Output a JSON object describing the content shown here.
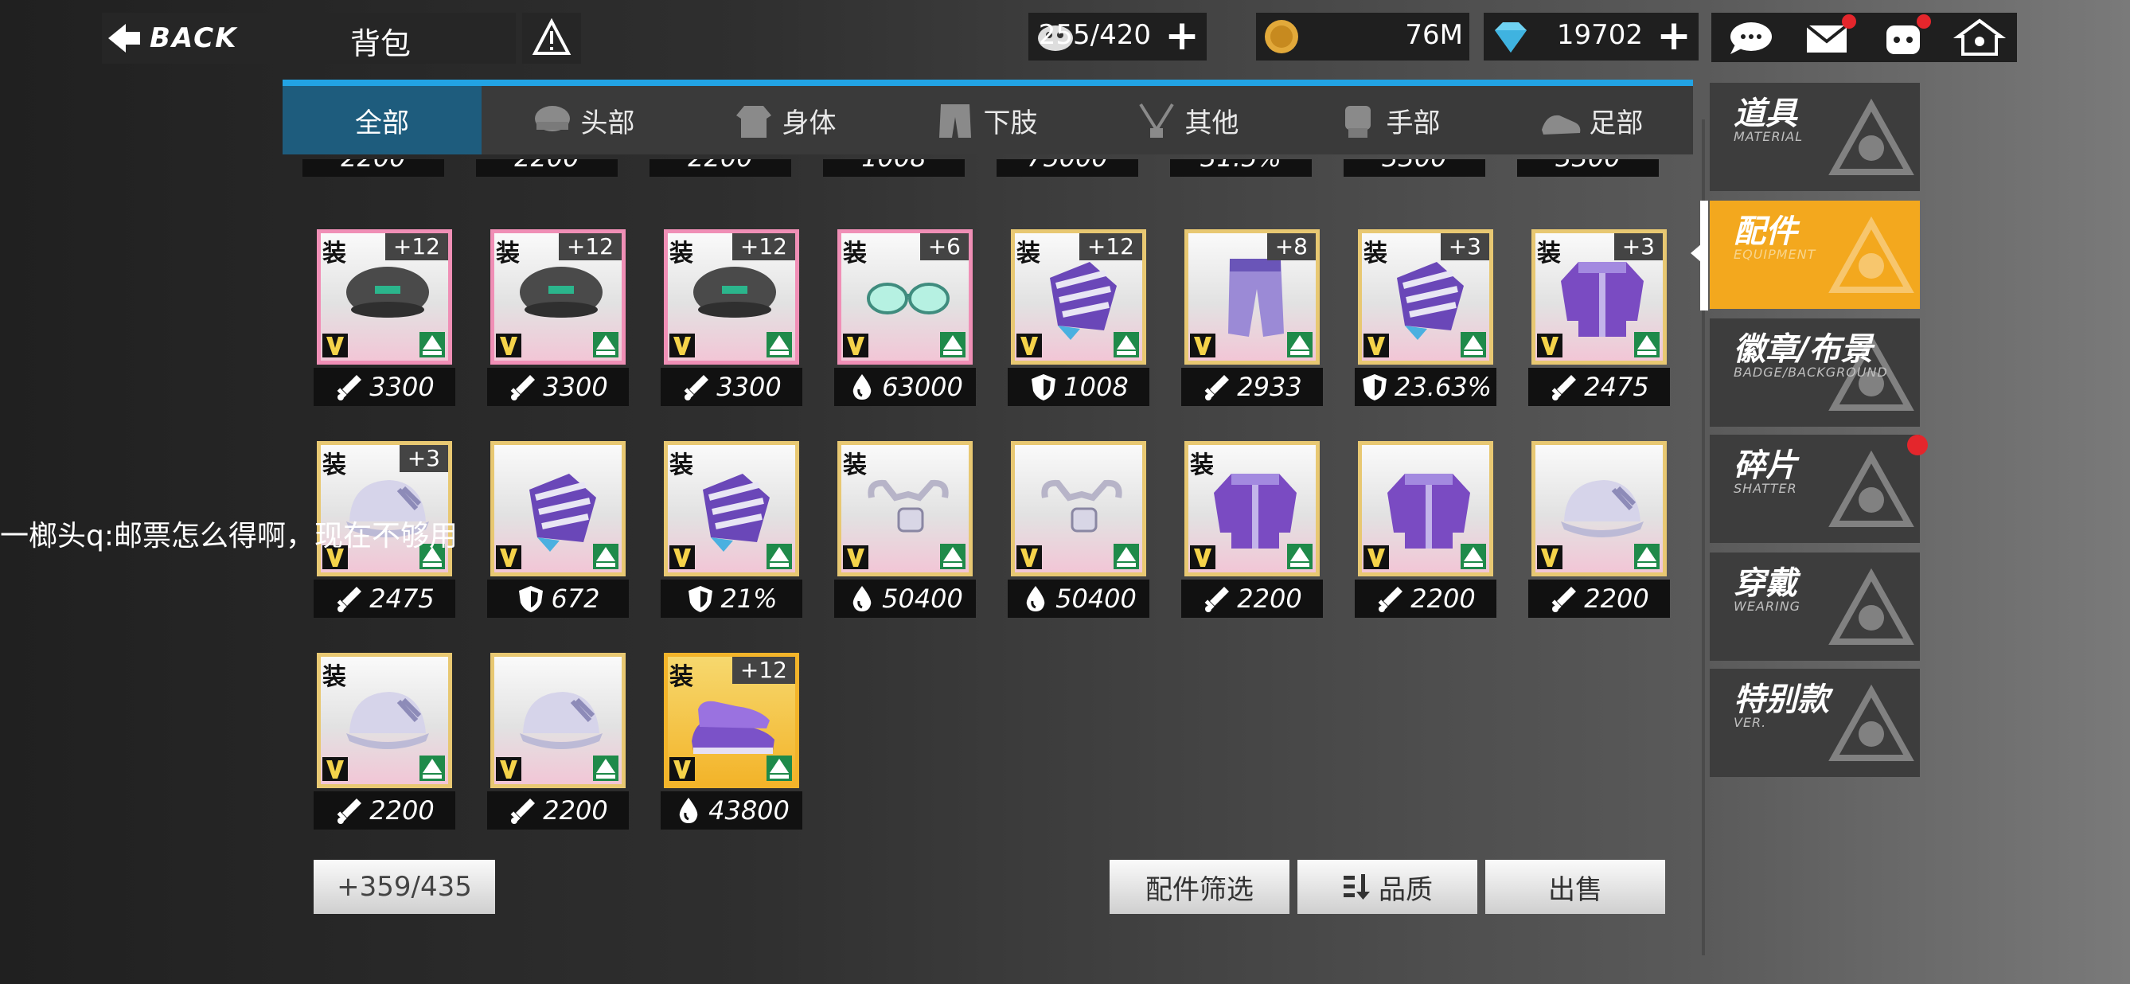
{
  "topbar": {
    "back_label": "BACK",
    "title": "背包",
    "resources": [
      {
        "icon": "stamina-icon",
        "value": "255/420",
        "plus": "+"
      },
      {
        "icon": "coin-icon",
        "value": "76M",
        "plus": ""
      },
      {
        "icon": "diamond-icon",
        "value": "19702",
        "plus": "+"
      }
    ],
    "icons": [
      "chat-icon",
      "mail-icon",
      "character-icon",
      "home-icon"
    ]
  },
  "tabs": [
    {
      "label": "全部",
      "icon": "",
      "active": true
    },
    {
      "label": "头部",
      "icon": "head-icon"
    },
    {
      "label": "身体",
      "icon": "body-icon"
    },
    {
      "label": "下肢",
      "icon": "legs-icon"
    },
    {
      "label": "其他",
      "icon": "misc-icon"
    },
    {
      "label": "手部",
      "icon": "hand-icon"
    },
    {
      "label": "足部",
      "icon": "foot-icon"
    }
  ],
  "partial_row": [
    "2200",
    "2200",
    "2200",
    "1008",
    "75000",
    "31.5%",
    "3300",
    "3300"
  ],
  "items": [
    {
      "equipped": "装",
      "level": "+12",
      "type": "cap",
      "border": "pink",
      "stat_icon": "sword-icon",
      "stat": "3300"
    },
    {
      "equipped": "装",
      "level": "+12",
      "type": "cap",
      "border": "pink",
      "stat_icon": "sword-icon",
      "stat": "3300"
    },
    {
      "equipped": "装",
      "level": "+12",
      "type": "cap",
      "border": "pink",
      "stat_icon": "sword-icon",
      "stat": "3300"
    },
    {
      "equipped": "装",
      "level": "+6",
      "type": "glasses",
      "border": "pink",
      "stat_icon": "drop-icon",
      "stat": "63000"
    },
    {
      "equipped": "装",
      "level": "+12",
      "type": "glove",
      "border": "gold",
      "stat_icon": "shield-icon",
      "stat": "1008"
    },
    {
      "equipped": "",
      "level": "+8",
      "type": "pants",
      "border": "gold",
      "stat_icon": "sword-icon",
      "stat": "2933"
    },
    {
      "equipped": "装",
      "level": "+3",
      "type": "glove",
      "border": "gold",
      "stat_icon": "shield-icon",
      "stat": "23.63%"
    },
    {
      "equipped": "装",
      "level": "+3",
      "type": "jacket",
      "border": "gold",
      "stat_icon": "sword-icon",
      "stat": "2475"
    },
    {
      "equipped": "装",
      "level": "+3",
      "type": "whitecap",
      "border": "gold",
      "stat_icon": "sword-icon",
      "stat": "2475"
    },
    {
      "equipped": "",
      "level": "",
      "type": "glove",
      "border": "gold",
      "stat_icon": "shield-icon",
      "stat": "672"
    },
    {
      "equipped": "装",
      "level": "",
      "type": "glove",
      "border": "gold",
      "stat_icon": "shield-icon",
      "stat": "21%"
    },
    {
      "equipped": "装",
      "level": "",
      "type": "mask",
      "border": "gold",
      "stat_icon": "drop-icon",
      "stat": "50400"
    },
    {
      "equipped": "",
      "level": "",
      "type": "mask",
      "border": "gold",
      "stat_icon": "drop-icon",
      "stat": "50400"
    },
    {
      "equipped": "装",
      "level": "",
      "type": "jacket",
      "border": "gold",
      "stat_icon": "sword-icon",
      "stat": "2200"
    },
    {
      "equipped": "",
      "level": "",
      "type": "jacket",
      "border": "gold",
      "stat_icon": "sword-icon",
      "stat": "2200"
    },
    {
      "equipped": "",
      "level": "",
      "type": "whitecap",
      "border": "gold",
      "stat_icon": "sword-icon",
      "stat": "2200"
    },
    {
      "equipped": "装",
      "level": "",
      "type": "whitecap",
      "border": "gold",
      "stat_icon": "sword-icon",
      "stat": "2200"
    },
    {
      "equipped": "",
      "level": "",
      "type": "whitecap",
      "border": "gold",
      "stat_icon": "sword-icon",
      "stat": "2200"
    },
    {
      "equipped": "装",
      "level": "+12",
      "type": "shoes",
      "border": "goldbg",
      "stat_icon": "drop-icon",
      "stat": "43800"
    }
  ],
  "bottom": {
    "count": "+359/435",
    "filter": "配件筛选",
    "sort": "品质",
    "sell": "出售"
  },
  "categories": [
    {
      "title": "道具",
      "sub": "MATERIAL",
      "active": false,
      "dot": false
    },
    {
      "title": "配件",
      "sub": "EQUIPMENT",
      "active": true,
      "dot": false
    },
    {
      "title": "徽章/布景",
      "sub": "BADGE/BACKGROUND",
      "active": false,
      "dot": false
    },
    {
      "title": "碎片",
      "sub": "SHATTER",
      "active": false,
      "dot": true
    },
    {
      "title": "穿戴",
      "sub": "WEARING",
      "active": false,
      "dot": false
    },
    {
      "title": "特别款",
      "sub": "VER.",
      "active": false,
      "dot": false
    }
  ],
  "chat_overlay": "一榔头q:邮票怎么得啊，现在不够用",
  "colors": {
    "accent": "#22a3e4",
    "active_tab": "#1e5c7d",
    "active_category": "#f3a81e",
    "badge_red": "#e4262c"
  }
}
